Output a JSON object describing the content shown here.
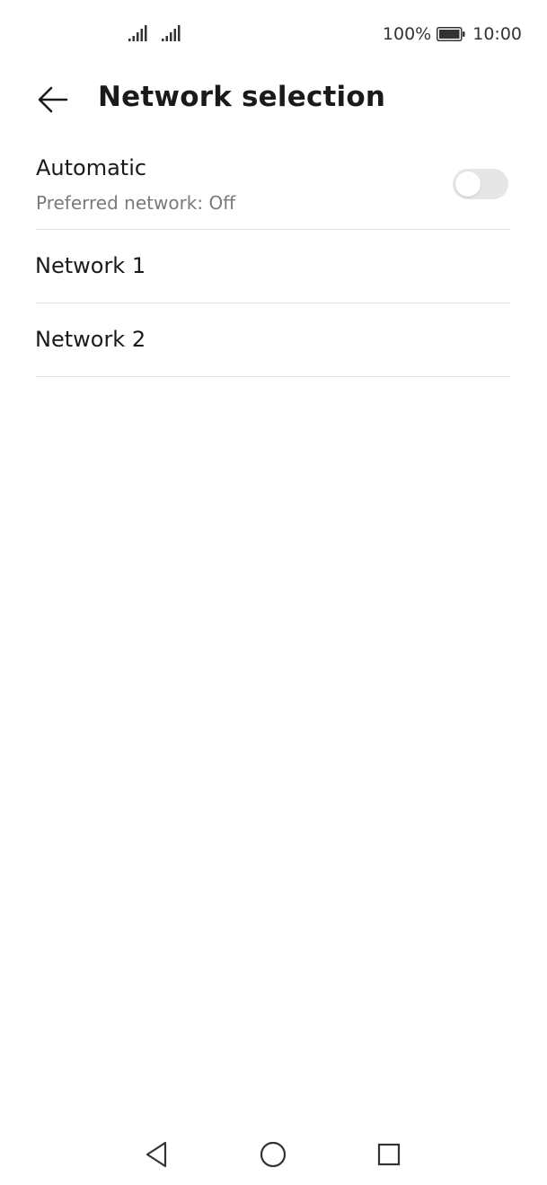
{
  "status_bar": {
    "battery_percent": "100%",
    "time": "10:00",
    "icons": [
      "signal-icon",
      "signal-icon",
      "battery-icon"
    ]
  },
  "header": {
    "title": "Network selection",
    "back_icon": "arrow-left-icon"
  },
  "automatic": {
    "label": "Automatic",
    "subtitle": "Preferred network: Off",
    "toggle_on": false
  },
  "networks": [
    {
      "label": "Network 1"
    },
    {
      "label": "Network 2"
    }
  ],
  "nav_bar": {
    "icons": [
      "nav-back-icon",
      "nav-home-icon",
      "nav-recents-icon"
    ]
  },
  "colors": {
    "divider": "#e3e3e3",
    "subtitle": "#7a7a7a",
    "toggle_off_track": "#e6e6e6"
  }
}
